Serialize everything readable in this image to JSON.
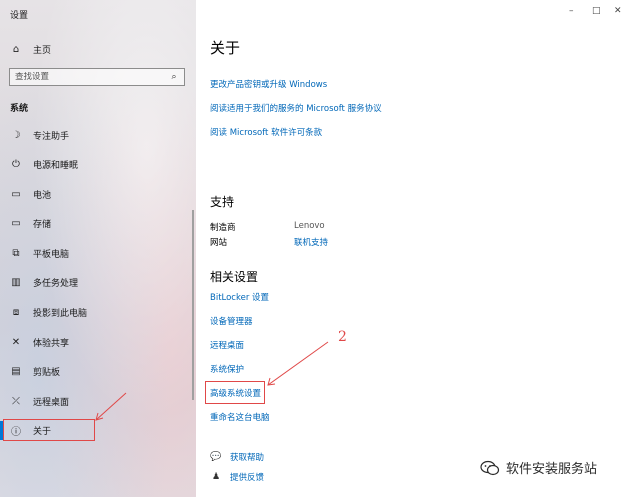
{
  "window": {
    "title": "设置",
    "controls": {
      "minimize": "–",
      "maximize": "□",
      "close": "✕"
    }
  },
  "sidebar": {
    "home": {
      "label": "主页",
      "icon": "home-icon"
    },
    "search": {
      "placeholder": "查找设置",
      "icon": "search-icon"
    },
    "section": "系统",
    "items": [
      {
        "label": "专注助手",
        "icon": "moon-icon"
      },
      {
        "label": "电源和睡眠",
        "icon": "power-icon"
      },
      {
        "label": "电池",
        "icon": "battery-icon"
      },
      {
        "label": "存储",
        "icon": "storage-icon"
      },
      {
        "label": "平板电脑",
        "icon": "tablet-icon"
      },
      {
        "label": "多任务处理",
        "icon": "multitasking-icon"
      },
      {
        "label": "投影到此电脑",
        "icon": "project-icon"
      },
      {
        "label": "体验共享",
        "icon": "share-experience-icon"
      },
      {
        "label": "剪贴板",
        "icon": "clipboard-icon"
      },
      {
        "label": "远程桌面",
        "icon": "remote-desktop-icon"
      },
      {
        "label": "关于",
        "icon": "info-icon",
        "selected": true
      }
    ]
  },
  "main": {
    "title": "关于",
    "top_links": [
      "更改产品密钥或升级 Windows",
      "阅读适用于我们的服务的 Microsoft 服务协议",
      "阅读 Microsoft 软件许可条款"
    ],
    "support": {
      "heading": "支持",
      "manufacturer_label": "制造商",
      "manufacturer_value": "Lenovo",
      "website_label": "网站",
      "website_value": "联机支持"
    },
    "related": {
      "heading": "相关设置",
      "links": [
        "BitLocker 设置",
        "设备管理器",
        "远程桌面",
        "系统保护",
        "高级系统设置",
        "重命名这台电脑"
      ]
    },
    "help": [
      {
        "label": "获取帮助",
        "icon": "help-icon"
      },
      {
        "label": "提供反馈",
        "icon": "feedback-icon"
      }
    ]
  },
  "annotation": {
    "number": "2",
    "highlight_color": "#e04848"
  },
  "watermark": {
    "text": "软件安装服务站",
    "icon": "wechat-icon"
  },
  "colors": {
    "accent": "#0078d7",
    "link": "#0067b8"
  }
}
